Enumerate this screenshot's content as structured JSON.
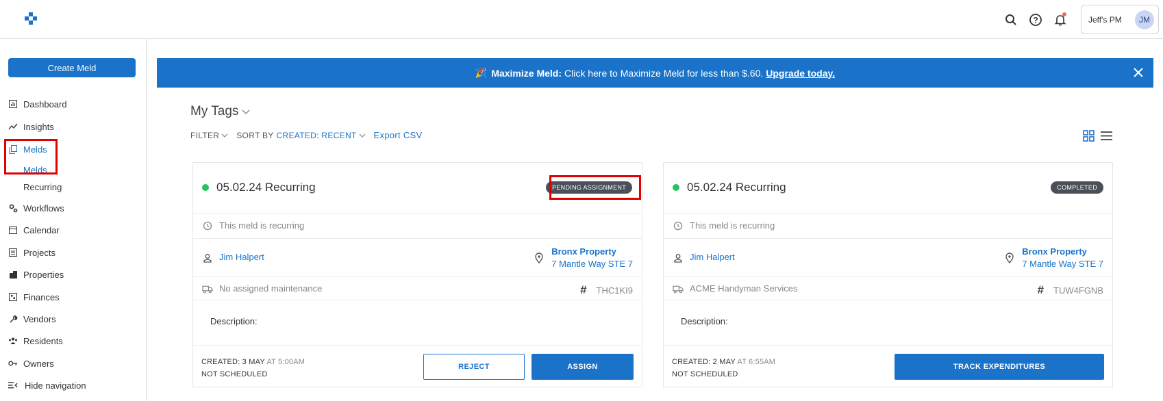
{
  "header": {
    "user_name": "Jeff's PM",
    "avatar_initials": "JM"
  },
  "sidebar": {
    "create_label": "Create Meld",
    "items": [
      {
        "label": "Dashboard",
        "icon": "dashboard-icon"
      },
      {
        "label": "Insights",
        "icon": "insights-icon"
      },
      {
        "label": "Melds",
        "icon": "melds-icon"
      },
      {
        "label": "Workflows",
        "icon": "workflows-icon"
      },
      {
        "label": "Calendar",
        "icon": "calendar-icon"
      },
      {
        "label": "Projects",
        "icon": "projects-icon"
      },
      {
        "label": "Properties",
        "icon": "properties-icon"
      },
      {
        "label": "Finances",
        "icon": "finances-icon"
      },
      {
        "label": "Vendors",
        "icon": "vendors-icon"
      },
      {
        "label": "Residents",
        "icon": "residents-icon"
      },
      {
        "label": "Owners",
        "icon": "owners-icon"
      },
      {
        "label": "Hide navigation",
        "icon": "hide-nav-icon"
      }
    ],
    "sub_items": [
      "Melds",
      "Recurring"
    ]
  },
  "banner": {
    "emoji": "🎉",
    "bold": "Maximize Meld:",
    "text": "Click here to Maximize Meld for less than $.60.",
    "link": "Upgrade today."
  },
  "main": {
    "title": "My Tags",
    "filter_label": "FILTER",
    "sort_prefix": "SORT BY",
    "sort_value": "CREATED: RECENT",
    "export_label": "Export CSV"
  },
  "cards": [
    {
      "title": "05.02.24 Recurring",
      "status": "PENDING ASSIGNMENT",
      "recurring_text": "This meld is recurring",
      "resident": "Jim Halpert",
      "property_name": "Bronx Property",
      "property_address": "7 Mantle Way STE 7",
      "maintenance": "No assigned maintenance",
      "ref": "THC1KI9",
      "description_label": "Description:",
      "created_label": "CREATED: 3 MAY",
      "created_time": "AT 5:00AM",
      "schedule": "NOT SCHEDULED",
      "btn_reject": "REJECT",
      "btn_assign": "ASSIGN"
    },
    {
      "title": "05.02.24 Recurring",
      "status": "COMPLETED",
      "recurring_text": "This meld is recurring",
      "resident": "Jim Halpert",
      "property_name": "Bronx Property",
      "property_address": "7 Mantle Way STE 7",
      "maintenance": "ACME Handyman Services",
      "ref": "TUW4FGNB",
      "description_label": "Description:",
      "created_label": "CREATED: 2 MAY",
      "created_time": "AT 6:55AM",
      "schedule": "NOT SCHEDULED",
      "btn_track": "TRACK EXPENDITURES"
    }
  ],
  "colors": {
    "accent": "#1a73c9",
    "status_dot": "#22c55e",
    "highlight": "#e00000"
  }
}
